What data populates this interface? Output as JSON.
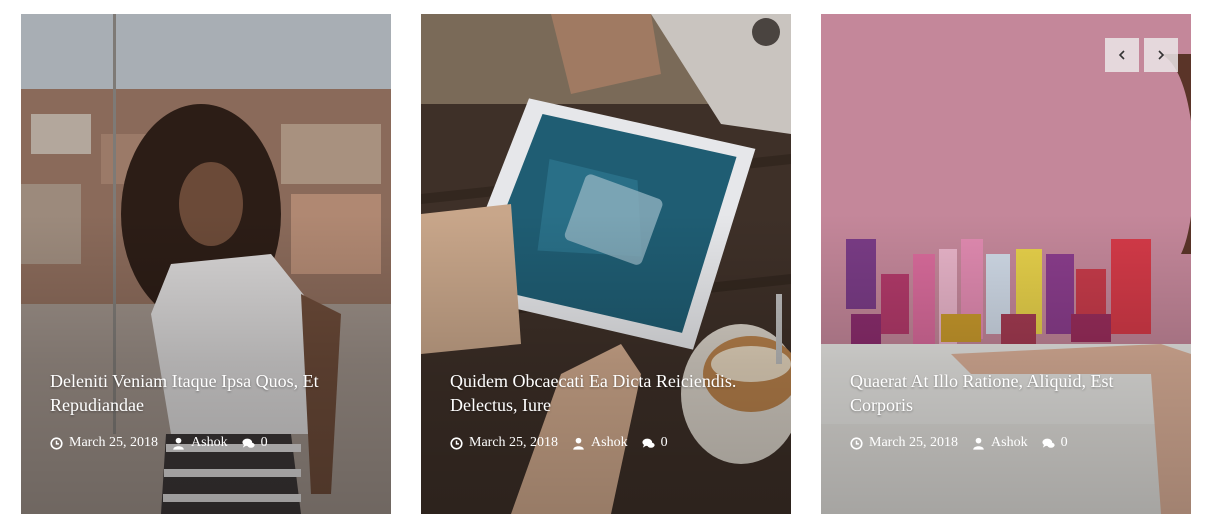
{
  "posts": [
    {
      "title": "Deleniti Veniam Itaque Ipsa Quos, Et Repudiandae",
      "date": "March 25, 2018",
      "author": "Ashok",
      "comments": "0",
      "date_icon": "clock-icon",
      "author_icon": "user-icon",
      "comments_icon": "comments-icon"
    },
    {
      "title": "Quidem Obcaecati Ea Dicta Reiciendis. Delectus, Iure",
      "date": "March 25, 2018",
      "author": "Ashok",
      "comments": "0",
      "date_icon": "clock-icon",
      "author_icon": "user-icon",
      "comments_icon": "comments-icon"
    },
    {
      "title": "Quaerat At Illo Ratione, Aliquid, Est Corporis",
      "date": "March 25, 2018",
      "author": "Ashok",
      "comments": "0",
      "date_icon": "clock-icon",
      "author_icon": "user-icon",
      "comments_icon": "comments-icon"
    }
  ],
  "carousel_nav": {
    "prev_icon": "chevron-left-icon",
    "next_icon": "chevron-right-icon"
  },
  "colors": {
    "overlay_text": "#ffffff",
    "nav_button_bg": "#ebe6e8",
    "nav_icon": "#333333"
  }
}
